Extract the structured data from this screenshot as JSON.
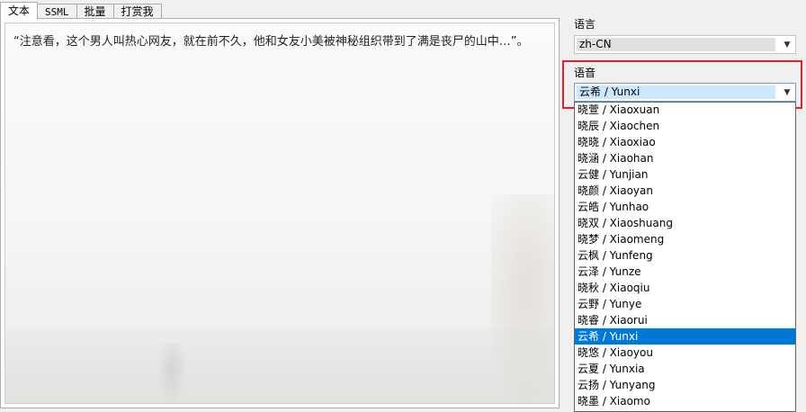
{
  "tabs": [
    {
      "label": "文本"
    },
    {
      "label": "SSML"
    },
    {
      "label": "批量"
    },
    {
      "label": "打赏我"
    }
  ],
  "editor": {
    "text": "“注意看，这个男人叫热心网友，就在前不久，他和女友小美被神秘组织带到了满是丧尸的山中…”。"
  },
  "language": {
    "label": "语言",
    "value": "zh-CN"
  },
  "voice": {
    "label": "语音",
    "value": "云希 / Yunxi",
    "options": [
      "晓萱 / Xiaoxuan",
      "晓辰 / Xiaochen",
      "晓晓 / Xiaoxiao",
      "晓涵 / Xiaohan",
      "云健 / Yunjian",
      "晓颜 / Xiaoyan",
      "云皓 / Yunhao",
      "晓双 / Xiaoshuang",
      "晓梦 / Xiaomeng",
      "云枫 / Yunfeng",
      "云泽 / Yunze",
      "晓秋 / Xiaoqiu",
      "云野 / Yunye",
      "晓睿 / Xiaorui",
      "云希 / Yunxi",
      "晓悠 / Xiaoyou",
      "云夏 / Yunxia",
      "云扬 / Yunyang",
      "晓墨 / Xiaomo"
    ],
    "selected_option": "云希 / Yunxi"
  },
  "colors": {
    "selection": "#0078d7",
    "highlight_box": "#e0202a"
  }
}
